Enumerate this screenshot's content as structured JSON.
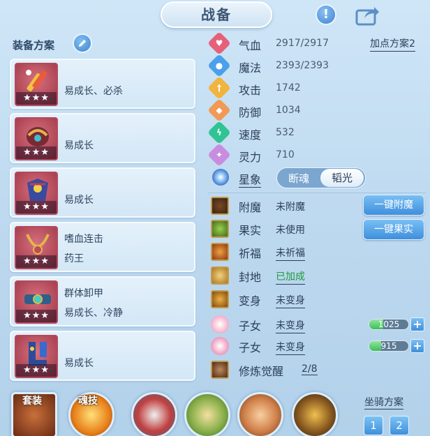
{
  "header": {
    "title": "战备"
  },
  "equipment": {
    "section_title": "装备方案",
    "items": [
      {
        "line1": "",
        "line2": "易成长、必杀",
        "stars": "★★★"
      },
      {
        "line1": "",
        "line2": "易成长",
        "stars": "★★★"
      },
      {
        "line1": "",
        "line2": "易成长",
        "stars": "★★★"
      },
      {
        "line1": "嗜血连击",
        "line2": "药王",
        "stars": "★★★"
      },
      {
        "line1": "群体卸甲",
        "line2": "易成长、冷静",
        "stars": "★★★"
      },
      {
        "line1": "",
        "line2": "易成长",
        "stars": "★★★"
      }
    ]
  },
  "stats": {
    "plan_link": "加点方案2",
    "rows": [
      {
        "label": "气血",
        "value": "2917/2917",
        "icon": "heart-icon",
        "color": "#e6607a"
      },
      {
        "label": "魔法",
        "value": "2393/2393",
        "icon": "mana-icon",
        "color": "#4aa0ea"
      },
      {
        "label": "攻击",
        "value": "1742",
        "icon": "sword-icon",
        "color": "#f1b43e"
      },
      {
        "label": "防御",
        "value": "1034",
        "icon": "shield-icon",
        "color": "#f09a55"
      },
      {
        "label": "速度",
        "value": "532",
        "icon": "speed-icon",
        "color": "#2fc493"
      },
      {
        "label": "灵力",
        "value": "710",
        "icon": "spirit-icon",
        "color": "#c98de0"
      }
    ],
    "constellation": {
      "label": "星象",
      "option_left": "断魂",
      "option_right": "韬光"
    }
  },
  "features": {
    "enchant": {
      "label": "附魔",
      "value": "未附魔",
      "button": "一键附魔"
    },
    "fruit": {
      "label": "果实",
      "value": "未使用",
      "button": "一键果实"
    },
    "blessing": {
      "label": "祈福",
      "value": "未祈福"
    },
    "fengdi": {
      "label": "封地",
      "value": "已加成"
    },
    "transform": {
      "label": "变身",
      "value": "未变身"
    },
    "child1": {
      "label": "子女",
      "value": "未变身",
      "bar_value": "1025",
      "fill": 0.35
    },
    "child2": {
      "label": "子女",
      "value": "未变身",
      "bar_value": "915",
      "fill": 0.3
    },
    "cultivation": {
      "label": "修炼觉醒",
      "value": "2/8"
    }
  },
  "bottom": {
    "suit_label": "套装",
    "soul_skill_label": "魂技",
    "mount_title": "坐骑方案",
    "mount_buttons": [
      "1",
      "2"
    ]
  }
}
